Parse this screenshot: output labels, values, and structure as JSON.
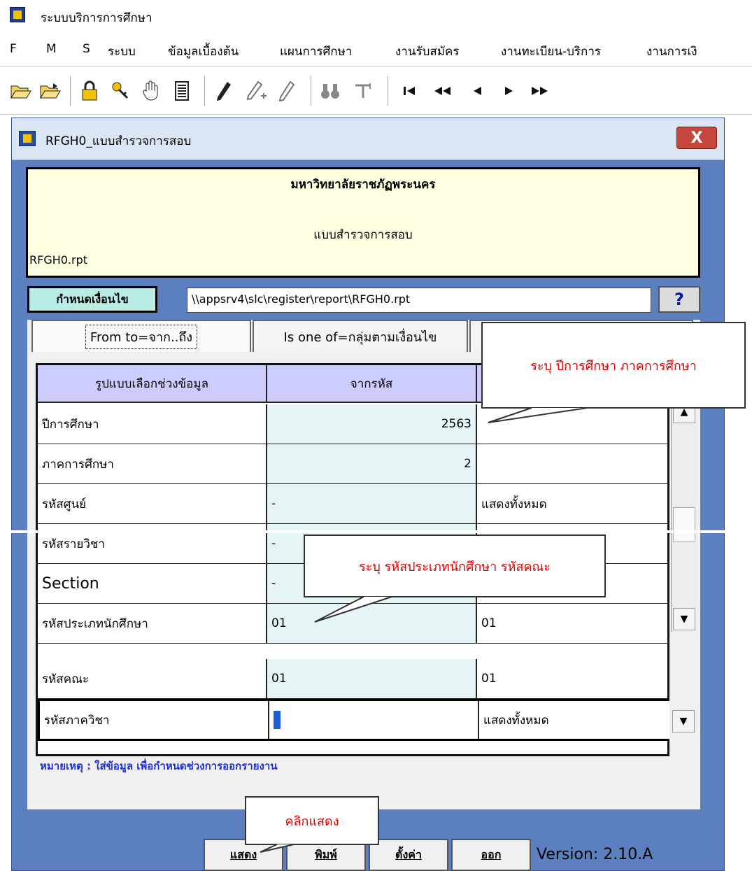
{
  "app": {
    "title": "ระบบบริการการศึกษา",
    "icon": "app-icon"
  },
  "menu": {
    "items": [
      "F",
      "M",
      "S",
      "ระบบ",
      "ข้อมูลเบื้องต้น",
      "แผนการศึกษา",
      "งานรับสมัคร",
      "งานทะเบียน-บริการ",
      "งานการเงิ"
    ]
  },
  "toolbar": {
    "icons": [
      "open-folder-icon",
      "export-folder-icon",
      "lock-icon",
      "keys-icon",
      "hand-icon",
      "document-icon",
      "pencil-icon",
      "pencil-add-icon",
      "pencil-delete-icon",
      "binoculars-icon",
      "filter-icon",
      "first-record-icon",
      "rewind-icon",
      "previous-icon",
      "next-icon",
      "fast-forward-icon"
    ]
  },
  "window": {
    "title": "RFGH0_แบบสำรวจการสอบ",
    "close_label": "X"
  },
  "header": {
    "university": "มหาวิทยาลัยราชภัฏพระนคร",
    "report_title": "แบบสำรวจการสอบ",
    "report_file": "RFGH0.rpt"
  },
  "condition": {
    "label": "กำหนดเงื่อนไข",
    "path": "\\\\appsrv4\\slc\\register\\report\\RFGH0.rpt",
    "help_label": "?"
  },
  "tabs": [
    {
      "label": "From to=จาก..ถึง",
      "selected": true
    },
    {
      "label": "Is one of=กลุ่มตามเงื่อนไข",
      "selected": false
    },
    {
      "label": "",
      "selected": false
    }
  ],
  "grid": {
    "headers": [
      "รูปแบบเลือกช่วงข้อมูล",
      "จากรหัส",
      ""
    ],
    "rows": [
      {
        "field": "ปีการศึกษา",
        "from": "2563",
        "to": ""
      },
      {
        "field": "ภาคการศึกษา",
        "from": "2",
        "to": ""
      },
      {
        "field": "รหัสศูนย์",
        "from": "-",
        "to": "แสดงทั้งหมด"
      },
      {
        "field": "รหัสรายวิชา",
        "from": "-",
        "to": ""
      },
      {
        "field": "Section",
        "from": "-",
        "to": ""
      },
      {
        "field": "รหัสประเภทนักศึกษา",
        "from": "01",
        "to": "01"
      },
      {
        "field": "รหัสคณะ",
        "from": "01",
        "to": "01"
      },
      {
        "field": "รหัสภาควิชา",
        "from": "",
        "to": "แสดงทั้งหมด"
      }
    ]
  },
  "note": "หมายเหตุ : ใส่ข้อมูล เพื่อกำหนดช่วงการออกรายงาน",
  "buttons": {
    "show": "แสดง",
    "print": "พิมพ์",
    "settings": "ตั้งค่า",
    "exit": "ออก"
  },
  "version": "Version: 2.10.A",
  "callouts": {
    "year_term": "ระบุ ปีการศึกษา ภาคการศึกษา",
    "type_faculty": "ระบุ รหัสประเภทนักศึกษา รหัสคณะ",
    "click_show": "คลิกแสดง"
  },
  "colors": {
    "header_bg": "#ffffe1",
    "grid_header_bg": "#ccccff",
    "window_bg": "#5b7fbf",
    "callout_text": "#e00000",
    "note_text": "#1e2fd8"
  }
}
